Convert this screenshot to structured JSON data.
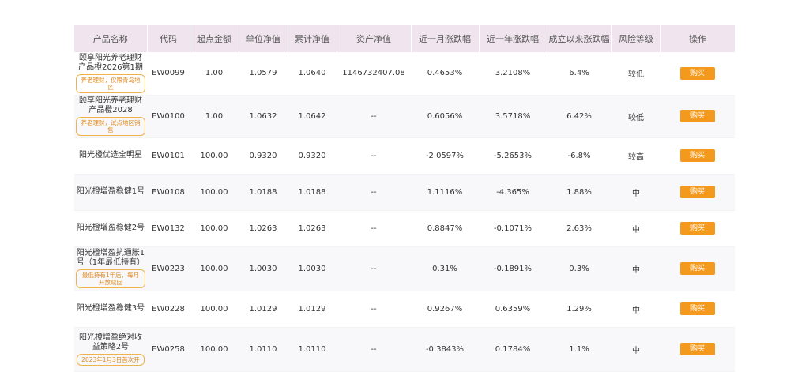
{
  "headers": [
    "产品名称",
    "代码",
    "起点金额",
    "单位净值",
    "累计净值",
    "资产净值",
    "近一月涨跌幅",
    "近一年涨跌幅",
    "成立以来涨跌幅",
    "风险等级",
    "操作"
  ],
  "rows": [
    {
      "name": "颐享阳光养老理财产品橙2026第1期",
      "tag": "养老理财，仅限青岛地区",
      "code": "EW0099",
      "min": "1.00",
      "nav": "1.0579",
      "cum": "1.0640",
      "asset": "1146732407.08",
      "m1": "0.4653%",
      "y1": "3.2108%",
      "since": "6.4%",
      "risk": "较低",
      "action": "购买"
    },
    {
      "name": "颐享阳光养老理财产品橙2028",
      "tag": "养老理财，试点地区销售",
      "code": "EW0100",
      "min": "1.00",
      "nav": "1.0632",
      "cum": "1.0642",
      "asset": "--",
      "m1": "0.6056%",
      "y1": "3.5718%",
      "since": "6.42%",
      "risk": "较低",
      "action": "购买"
    },
    {
      "name": "阳光橙优选全明星",
      "tag": "",
      "code": "EW0101",
      "min": "100.00",
      "nav": "0.9320",
      "cum": "0.9320",
      "asset": "--",
      "m1": "-2.0597%",
      "y1": "-5.2653%",
      "since": "-6.8%",
      "risk": "较高",
      "action": "购买"
    },
    {
      "name": "阳光橙增盈稳健1号",
      "tag": "",
      "code": "EW0108",
      "min": "100.00",
      "nav": "1.0188",
      "cum": "1.0188",
      "asset": "--",
      "m1": "1.1116%",
      "y1": "-4.365%",
      "since": "1.88%",
      "risk": "中",
      "action": "购买"
    },
    {
      "name": "阳光橙增盈稳健2号",
      "tag": "",
      "code": "EW0132",
      "min": "100.00",
      "nav": "1.0263",
      "cum": "1.0263",
      "asset": "--",
      "m1": "0.8847%",
      "y1": "-0.1071%",
      "since": "2.63%",
      "risk": "中",
      "action": "购买"
    },
    {
      "name": "阳光橙增盈抗通胀1号（1年最低持有）",
      "tag": "最低持有1年后，每月开放赎回",
      "code": "EW0223",
      "min": "100.00",
      "nav": "1.0030",
      "cum": "1.0030",
      "asset": "--",
      "m1": "0.31%",
      "y1": "-0.1891%",
      "since": "0.3%",
      "risk": "中",
      "action": "购买"
    },
    {
      "name": "阳光橙增盈稳健3号",
      "tag": "",
      "code": "EW0228",
      "min": "100.00",
      "nav": "1.0129",
      "cum": "1.0129",
      "asset": "--",
      "m1": "0.9267%",
      "y1": "0.6359%",
      "since": "1.29%",
      "risk": "中",
      "action": "购买"
    },
    {
      "name": "阳光橙增盈绝对收益策略2号",
      "tag": "2023年1月3日首次开",
      "code": "EW0258",
      "min": "100.00",
      "nav": "1.0110",
      "cum": "1.0110",
      "asset": "--",
      "m1": "-0.3843%",
      "y1": "0.1784%",
      "since": "1.1%",
      "risk": "中",
      "action": "购买"
    }
  ]
}
